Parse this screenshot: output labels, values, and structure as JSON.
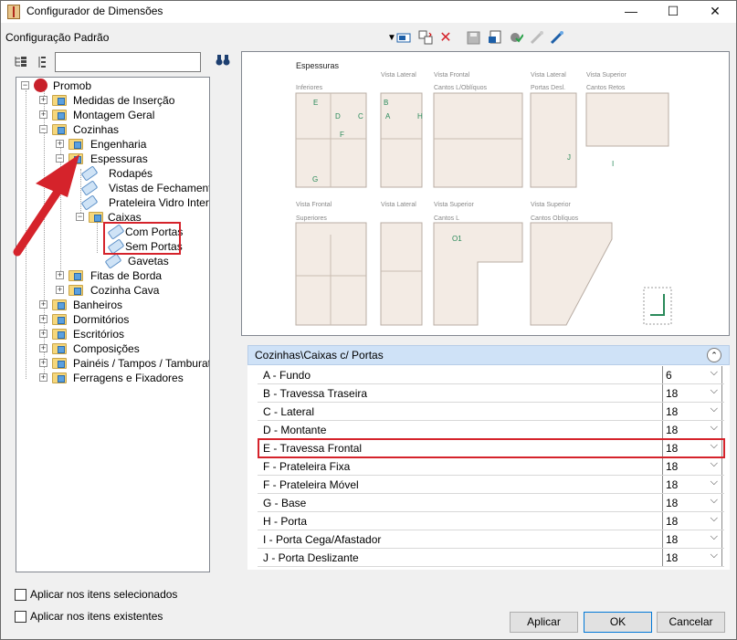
{
  "window": {
    "title": "Configurador de Dimensões",
    "minimize": "—",
    "maximize": "☐",
    "close": "✕"
  },
  "toolbar": {
    "config_label": "Configuração Padrão"
  },
  "tree": {
    "root": "Promob",
    "items": [
      "Medidas de Inserção",
      "Montagem Geral",
      "Cozinhas",
      "Engenharia",
      "Espessuras",
      "Rodapés",
      "Vistas de Fechamento",
      "Prateleira Vidro Interna",
      "Caixas",
      "Com Portas",
      "Sem Portas",
      "Gavetas",
      "Fitas de Borda",
      "Cozinha Cava",
      "Banheiros",
      "Dormitórios",
      "Escritórios",
      "Composições",
      "Painéis / Tampos / Tamburatos",
      "Ferragens e Fixadores"
    ]
  },
  "preview": {
    "section_title": "Espessuras",
    "top_labels": [
      "Inferiores",
      "Vista Lateral",
      "Vista Frontal",
      "Cantos L/Oblíquos",
      "Vista Lateral",
      "Portas Desl.",
      "Vista Superior",
      "Cantos Retos"
    ],
    "vista_frontal": "Vista Frontal",
    "bottom_labels": [
      "Vista Frontal",
      "Superiores",
      "Vista Lateral",
      "Vista Superior",
      "Cantos L",
      "Vista Superior",
      "Cantos Oblíquos"
    ],
    "letters": [
      "E",
      "D",
      "C",
      "F",
      "G",
      "B",
      "A",
      "H",
      "J",
      "I",
      "O1"
    ]
  },
  "props": {
    "header": "Cozinhas\\Caixas c/ Portas",
    "rows": [
      {
        "name": "A - Fundo",
        "value": "6"
      },
      {
        "name": "B - Travessa Traseira",
        "value": "18"
      },
      {
        "name": "C - Lateral",
        "value": "18"
      },
      {
        "name": "D - Montante",
        "value": "18"
      },
      {
        "name": "E - Travessa Frontal",
        "value": "18"
      },
      {
        "name": "F - Prateleira Fixa",
        "value": "18"
      },
      {
        "name": "F - Prateleira Móvel",
        "value": "18"
      },
      {
        "name": "G - Base",
        "value": "18"
      },
      {
        "name": "H - Porta",
        "value": "18"
      },
      {
        "name": "I - Porta Cega/Afastador",
        "value": "18"
      },
      {
        "name": "J - Porta Deslizante",
        "value": "18"
      }
    ]
  },
  "options": {
    "apply_selected": "Aplicar nos itens selecionados",
    "apply_existing": "Aplicar nos itens existentes"
  },
  "buttons": {
    "apply": "Aplicar",
    "ok": "OK",
    "cancel": "Cancelar"
  },
  "colors": {
    "highlight": "#d5232b",
    "header_bg": "#cfe2f7",
    "accent_green": "#2a8a5a"
  }
}
